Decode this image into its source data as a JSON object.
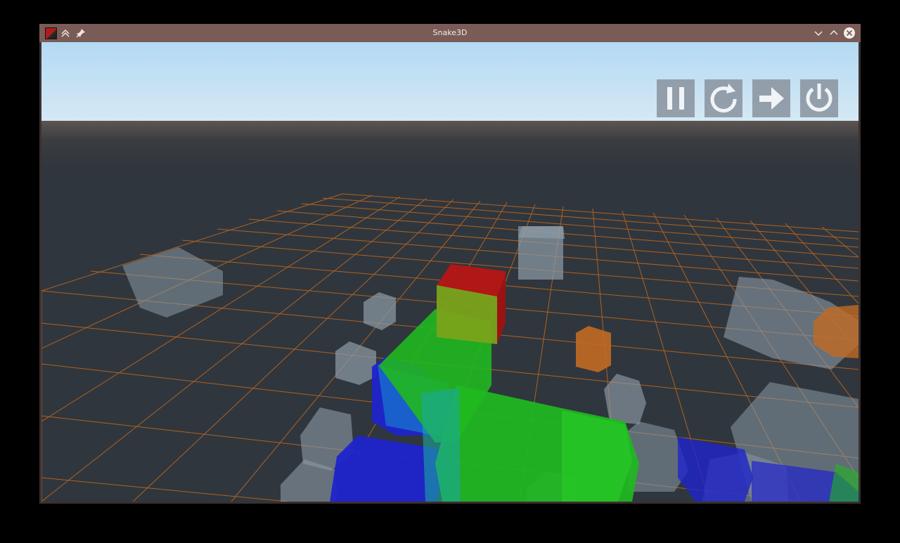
{
  "window": {
    "title": "Snake3D"
  },
  "icons": {
    "app": "snake3d-app-icon",
    "keep_above": "double-chevron-up-icon",
    "pin": "pin-icon",
    "minimize": "chevron-down-icon",
    "maximize": "chevron-up-icon",
    "close": "close-icon"
  },
  "hud": {
    "buttons": [
      "pause-icon",
      "restart-icon",
      "next-arrow-icon",
      "power-icon"
    ]
  },
  "colors": {
    "titlebar": "#7a5c56",
    "sky_top": "#b6dcf2",
    "ground": "#30363d",
    "grid": "#c56a1e",
    "snake_head": "#b01717",
    "snake_green": "#1fb51f",
    "snake_blue": "#1d22c8",
    "food": "#c26a22",
    "obstacle": "#7f8f9c",
    "hud_button": "#8e9aa5"
  }
}
